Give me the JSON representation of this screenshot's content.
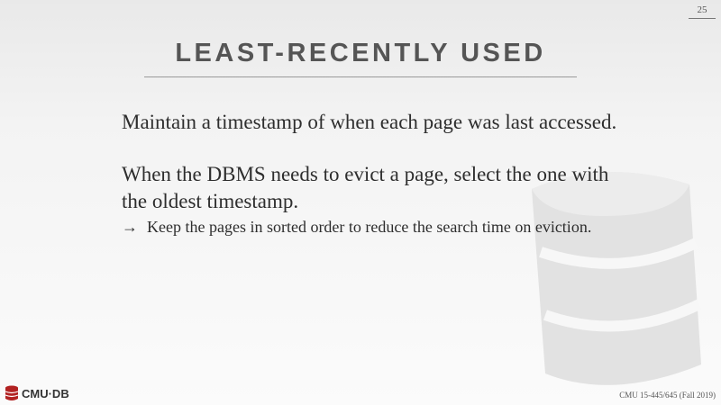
{
  "slide": {
    "number": "25",
    "title": "LEAST-RECENTLY USED",
    "paragraphs": [
      "Maintain a timestamp of when each page was last accessed.",
      "When the DBMS needs to evict a page, select the one with the oldest timestamp."
    ],
    "subbullet": {
      "arrow": "→",
      "text": "Keep the pages in sorted order to reduce the search time on eviction."
    }
  },
  "logo": {
    "text": "CMU·DB",
    "icon": "database-icon"
  },
  "footer": {
    "course": "CMU 15-445/645 (Fall 2019)"
  },
  "colors": {
    "logo_red": "#b22222",
    "watermark": "#e0e0e0"
  }
}
